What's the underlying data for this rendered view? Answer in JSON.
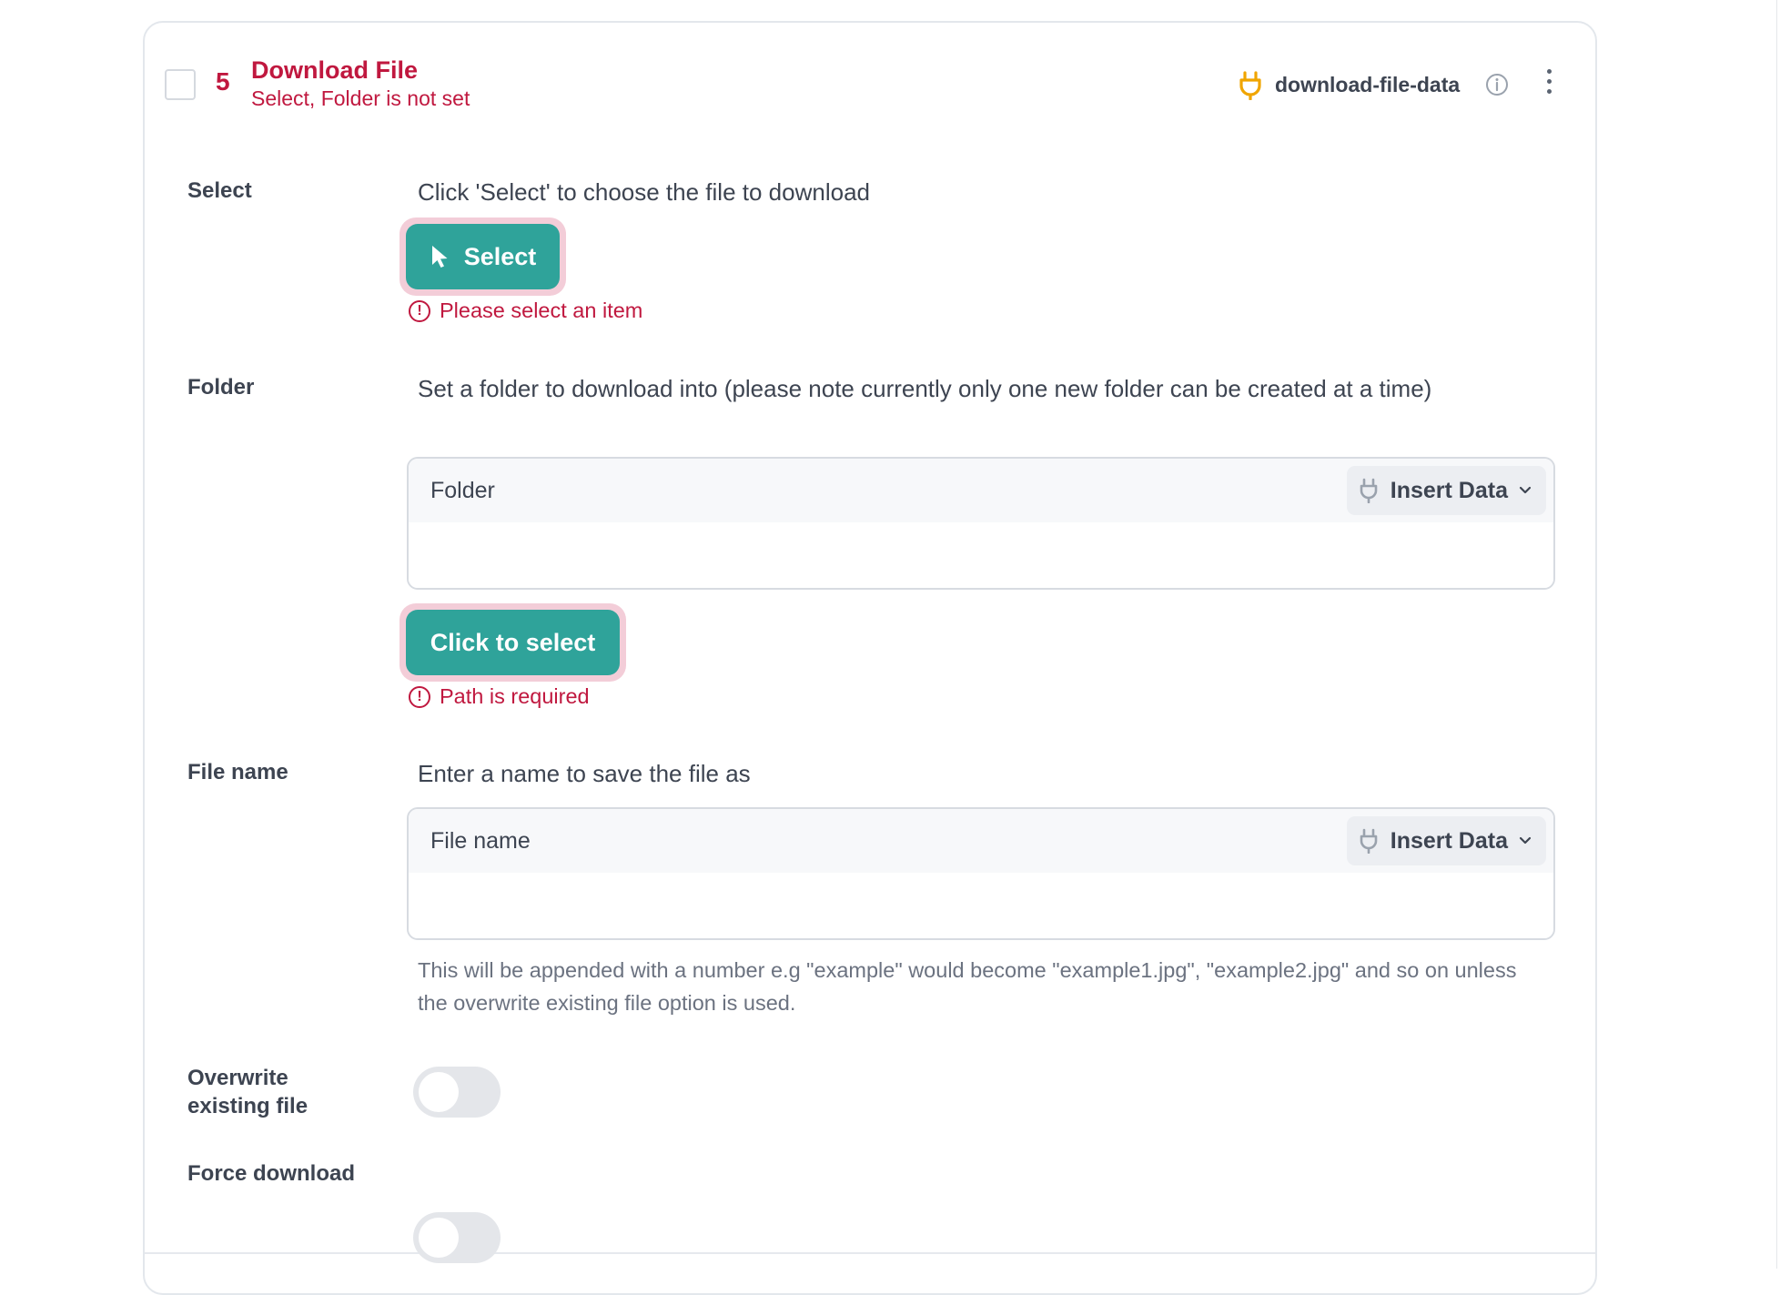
{
  "step": {
    "number": "5",
    "title": "Download File",
    "subtitle": "Select, Folder is not set",
    "data_tag": "download-file-data",
    "icons": {
      "plug": "plug-icon",
      "info": "info-icon",
      "menu": "more-vertical-icon"
    }
  },
  "select_field": {
    "label": "Select",
    "description": "Click 'Select' to choose the file to download",
    "button_label": "Select",
    "error": "Please select an item"
  },
  "folder_field": {
    "label": "Folder",
    "description": "Set a folder to download into (please note currently only one new folder can be created at a time)",
    "input_label": "Folder",
    "insert_label": "Insert Data",
    "button_label": "Click to select",
    "error": "Path is required"
  },
  "filename_field": {
    "label": "File name",
    "description": "Enter a name to save the file as",
    "input_label": "File name",
    "insert_label": "Insert Data",
    "hint": "This will be appended with a number e.g \"example\" would become \"example1.jpg\", \"example2.jpg\" and so on unless the overwrite existing file option is used."
  },
  "overwrite_field": {
    "label": "Overwrite existing file",
    "enabled": false
  },
  "force_field": {
    "label": "Force download",
    "enabled": false
  },
  "colors": {
    "error": "#c0183f",
    "accent": "#2fa39a",
    "plug": "#f0a500"
  }
}
